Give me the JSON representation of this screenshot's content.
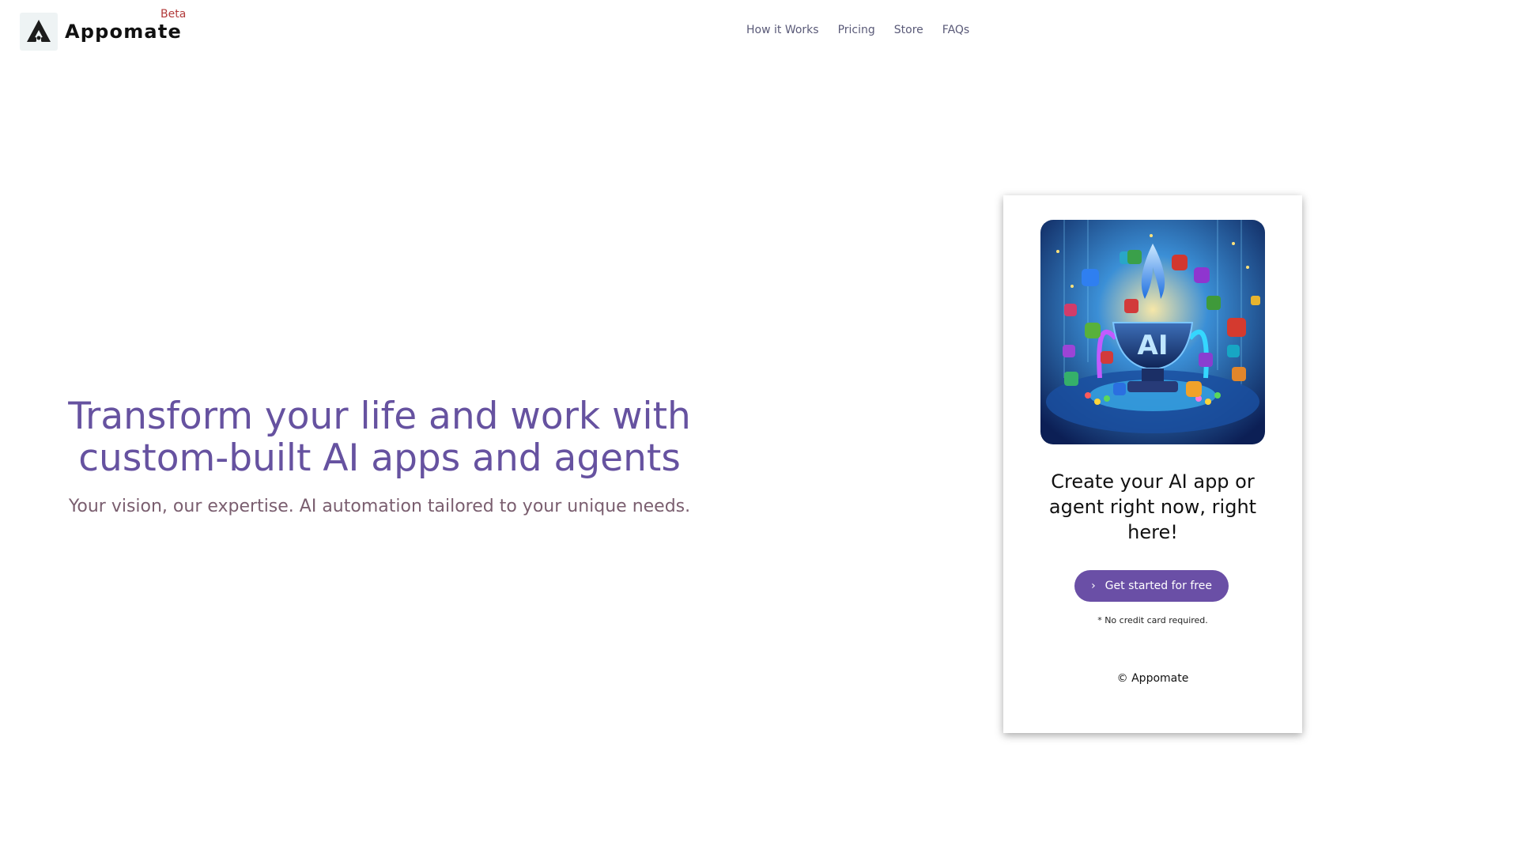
{
  "brand": {
    "name": "Appomate",
    "badge": "Beta"
  },
  "nav": {
    "items": [
      {
        "label": "How it Works"
      },
      {
        "label": "Pricing"
      },
      {
        "label": "Store"
      },
      {
        "label": "FAQs"
      }
    ]
  },
  "hero": {
    "title": "Transform your life and work with custom-built AI apps and agents",
    "subtitle": "Your vision, our expertise. AI automation tailored to your unique needs."
  },
  "card": {
    "image_text": "AI",
    "title": "Create your AI app or agent right now, right here!",
    "cta_label": "Get started for free",
    "cta_icon": "chevron-right-icon",
    "note": "* No credit card required.",
    "copyright": "© Appomate"
  },
  "colors": {
    "accent": "#6a4fa6",
    "headline": "#6652a0",
    "subtitle": "#7a5e6f",
    "beta": "#b23a3a"
  }
}
